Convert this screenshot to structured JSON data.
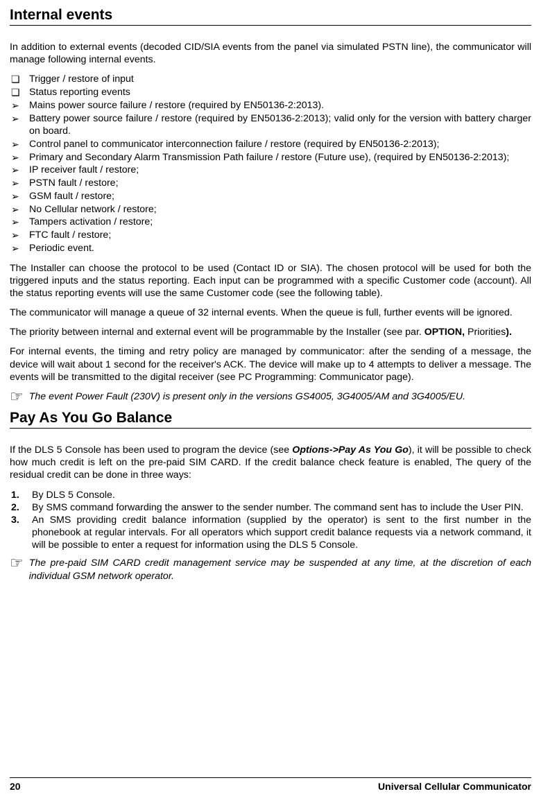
{
  "sections": {
    "internal_events_title": "Internal events",
    "pay_as_you_go_title": "Pay As You Go Balance"
  },
  "intro_para": "In addition to external events (decoded CID/SIA events from the panel via simulated PSTN line), the communicator will manage following internal events.",
  "bullets": {
    "b1": "Trigger / restore of input",
    "b2": "Status reporting events",
    "b3": "Mains power source failure / restore (required by EN50136-2:2013).",
    "b4": "Battery power source failure / restore (required by EN50136-2:2013); valid only for the version with battery charger on board.",
    "b5": "Control panel to communicator interconnection failure / restore (required by EN50136-2:2013);",
    "b6": "Primary and Secondary Alarm Transmission Path failure / restore (Future use), (required by EN50136-2:2013);",
    "b7": "IP receiver fault / restore;",
    "b8": "PSTN fault / restore;",
    "b9": "GSM fault / restore;",
    "b10": "No Cellular network / restore;",
    "b11": "Tampers activation / restore;",
    "b12": "FTC fault / restore;",
    "b13": "Periodic event."
  },
  "para2": "The Installer can choose the protocol to be used (Contact ID or SIA). The chosen protocol will be used for both the triggered inputs and the status reporting. Each input can be programmed with a specific Customer code (account). All the status reporting events will use the same Customer code (see the following table).",
  "para3": "The communicator will manage a queue of 32 internal events. When the queue is full, further events will be ignored.",
  "para4_pre": "The priority between internal and external event will be programmable by the Installer (see par. ",
  "para4_bold": "OPTION, ",
  "para4_post": "Priorities",
  "para4_end": ").",
  "para5": "For internal events, the timing and retry policy are managed by communicator: after the sending of a message, the device will wait about 1 second for the receiver's ACK. The device will make up to 4 attempts to deliver a message. The events will be transmitted to the digital receiver (see PC Programming: Communicator page).",
  "note1": "The event Power Fault (230V) is present only in the versions GS4005, 3G4005/AM and 3G4005/EU.",
  "payg_intro_pre": "If the DLS 5 Console has been used to program the device (see ",
  "payg_intro_bold": "Options->Pay As You Go",
  "payg_intro_post": "), it will be possible to check how much credit is left on the pre-paid SIM CARD. If the credit balance check feature is enabled, The query of the residual credit can be done in three ways:",
  "numbered": {
    "n1": "By DLS 5 Console.",
    "n2": "By SMS command forwarding the answer to the sender number. The command sent has to include the User PIN.",
    "n3": "An SMS providing credit balance information (supplied by the operator) is sent to the first number in the phonebook at regular intervals. For all operators which support credit balance requests via a network command, it will be possible to enter a request for information using the DLS 5 Console."
  },
  "note2": "The pre-paid SIM CARD credit management service may be suspended at any time, at the discretion of each individual GSM network operator.",
  "footer": {
    "page_number": "20",
    "doc_title": "Universal Cellular Communicator"
  }
}
